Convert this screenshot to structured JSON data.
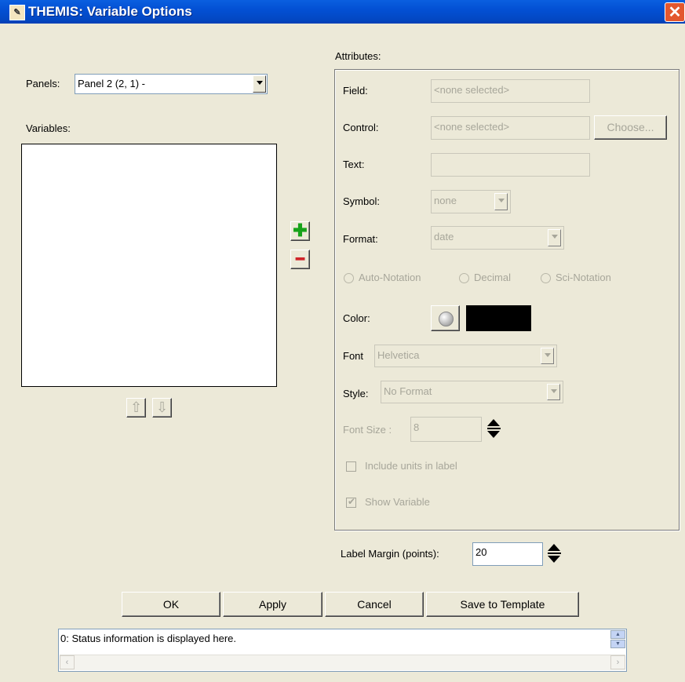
{
  "window": {
    "title": "THEMIS: Variable Options",
    "icon": "themis-app-icon",
    "close": "✕"
  },
  "panels": {
    "label": "Panels:",
    "selected": "Panel 2 (2, 1)  -"
  },
  "variables": {
    "label": "Variables:",
    "items": []
  },
  "add_button": "✚",
  "remove_button": "━",
  "move_up": "⇧",
  "move_down": "⇩",
  "attributes": {
    "title": "Attributes:",
    "field": {
      "label": "Field:",
      "value": "<none selected>"
    },
    "control": {
      "label": "Control:",
      "value": "<none selected>",
      "choose": "Choose..."
    },
    "text": {
      "label": "Text:",
      "value": ""
    },
    "symbol": {
      "label": "Symbol:",
      "value": "none"
    },
    "format": {
      "label": "Format:",
      "value": "date"
    },
    "notation": [
      "Auto-Notation",
      "Decimal",
      "Sci-Notation"
    ],
    "color": {
      "label": "Color:",
      "swatch": "#000000"
    },
    "font": {
      "label": "Font",
      "value": "Helvetica"
    },
    "style": {
      "label": "Style:",
      "value": "No Format"
    },
    "font_size": {
      "label": "Font Size :",
      "value": "8"
    },
    "include_units": "Include units in label",
    "show_variable": "Show Variable"
  },
  "label_margin": {
    "label": "Label Margin (points):",
    "value": "20"
  },
  "buttons": {
    "ok": "OK",
    "apply": "Apply",
    "cancel": "Cancel",
    "save": "Save to Template"
  },
  "status": {
    "text": "0: Status information is displayed here."
  }
}
